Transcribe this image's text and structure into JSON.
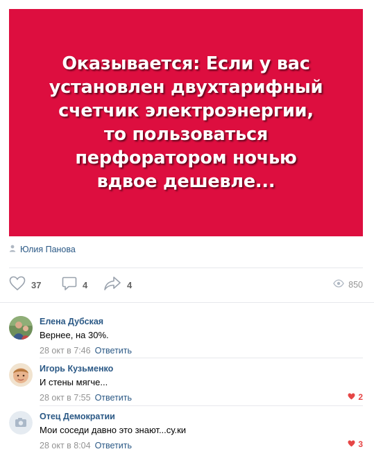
{
  "post": {
    "image_text": "Оказывается: Если у вас\nустановлен двухтарифный\nсчетчик электроэнергии,\nто пользоваться\nперфоратором ночью\nвдвое дешевле...",
    "author": "Юлия Панова",
    "likes": "37",
    "comments": "4",
    "shares": "4",
    "views": "850",
    "image_color": "#dd0e3f"
  },
  "comments": [
    {
      "author": "Елена Дубская",
      "text": "Вернее, на 30%.",
      "date": "28 окт в 7:46",
      "reply_label": "Ответить",
      "likes": ""
    },
    {
      "author": "Игорь Кузьменко",
      "text": "И стены мягче...",
      "date": "28 окт в 7:55",
      "reply_label": "Ответить",
      "likes": "2"
    },
    {
      "author": "Отец Демократии",
      "text": "Мои соседи давно это знают...су.ки",
      "date": "28 окт в 8:04",
      "reply_label": "Ответить",
      "likes": "3"
    }
  ],
  "icons": {
    "author": "person-icon",
    "like": "heart-outline-icon",
    "comment": "comment-bubble-icon",
    "share": "share-arrow-icon",
    "views": "eye-icon",
    "comment_like": "heart-filled-icon",
    "camera": "camera-icon"
  },
  "colors": {
    "link": "#2a5885",
    "muted": "#939393",
    "like_red": "#e64646"
  }
}
